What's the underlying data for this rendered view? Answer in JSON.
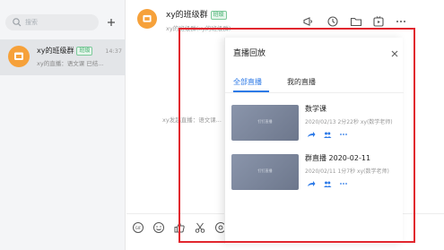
{
  "sidebar": {
    "search": {
      "placeholder": "搜索",
      "icon": "search-icon"
    },
    "add_icon": "plus-icon",
    "chats": [
      {
        "name": "xy的班级群",
        "badge": "班级",
        "time": "14:37",
        "preview": "xy的直播：语文课 已结..."
      }
    ]
  },
  "header": {
    "group_name": "xy的班级群",
    "badge": "班级",
    "sub": "xy的班级群(xy的班级群)",
    "tools": [
      "announcement-icon",
      "clock-icon",
      "folder-icon",
      "live-icon",
      "more-icon"
    ]
  },
  "chat": {
    "system_message": "xy发起直播：语文课..."
  },
  "input_toolbar": {
    "icons": [
      "gif-icon",
      "emoji-icon",
      "like-icon",
      "scissors-icon",
      "screenshot-icon"
    ]
  },
  "replay_panel": {
    "title": "直播回放",
    "tabs": [
      {
        "label": "全部直播",
        "active": true
      },
      {
        "label": "我的直播",
        "active": false
      }
    ],
    "items": [
      {
        "title": "数学课",
        "meta": "2020/02/13 2分22秒 xy(数学老师)",
        "thumb_text": "钉钉直播"
      },
      {
        "title": "群直播 2020-02-11",
        "meta": "2020/02/11 1分7秒 xy(数学老师)",
        "thumb_text": "钉钉直播"
      }
    ]
  },
  "colors": {
    "accent": "#2d7ae7",
    "highlight": "#e1262e",
    "avatar": "#f6a13a",
    "badge_green": "#3fae6b"
  }
}
